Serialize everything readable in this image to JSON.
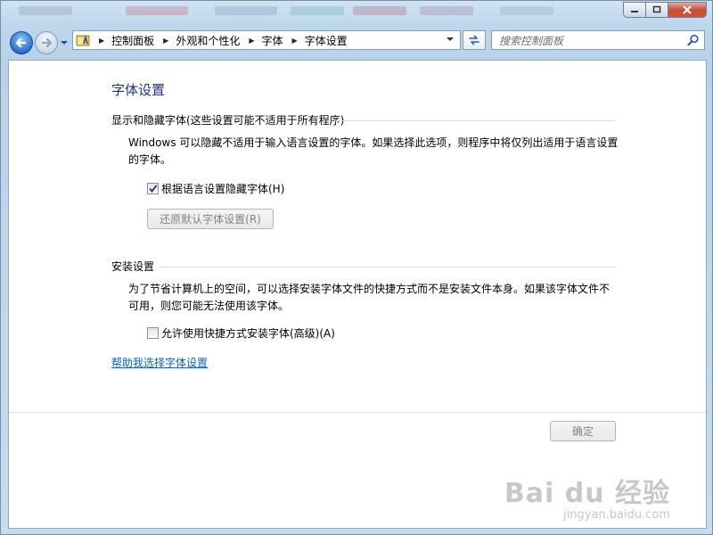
{
  "address_bar": {
    "breadcrumbs": [
      "控制面板",
      "外观和个性化",
      "字体",
      "字体设置"
    ]
  },
  "search": {
    "placeholder": "搜索控制面板"
  },
  "page": {
    "title": "字体设置",
    "section1": {
      "heading": "显示和隐藏字体(这些设置可能不适用于所有程序)",
      "description": "Windows 可以隐藏不适用于输入语言设置的字体。如果选择此选项，则程序中将仅列出适用于语言设置的字体。",
      "checkbox_label": "根据语言设置隐藏字体(H)",
      "checkbox_checked": true,
      "restore_button": "还原默认字体设置(R)"
    },
    "section2": {
      "heading": "安装设置",
      "description": "为了节省计算机上的空间，可以选择安装字体文件的快捷方式而不是安装文件本身。如果该字体文件不可用，则您可能无法使用该字体。",
      "checkbox_label": "允许使用快捷方式安装字体(高级)(A)",
      "checkbox_checked": false
    },
    "help_link": "帮助我选择字体设置",
    "ok_button": "确定"
  },
  "watermark": {
    "line1": "Bai du 经验",
    "line2": "jingyan.baidu.com"
  },
  "icons": {
    "back": "back-arrow-icon",
    "forward": "forward-arrow-icon",
    "folder": "control-panel-folder-icon",
    "refresh": "refresh-icon",
    "search": "magnifier-icon"
  },
  "colors": {
    "title": "#1e3287",
    "link": "#0066cc",
    "disabled_text": "#838383"
  }
}
